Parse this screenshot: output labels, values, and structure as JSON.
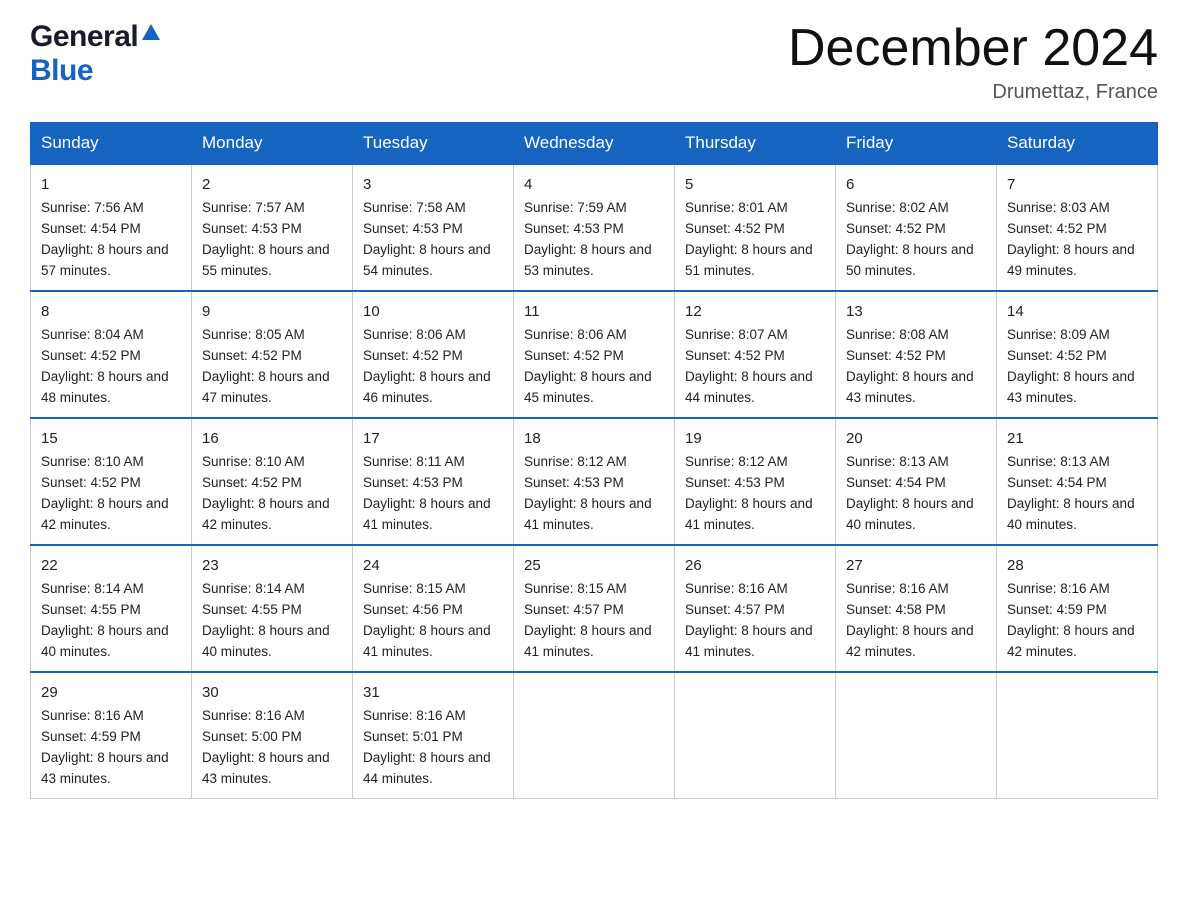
{
  "header": {
    "logo_general": "General",
    "logo_blue": "Blue",
    "month_title": "December 2024",
    "location": "Drumettaz, France"
  },
  "days_of_week": [
    "Sunday",
    "Monday",
    "Tuesday",
    "Wednesday",
    "Thursday",
    "Friday",
    "Saturday"
  ],
  "weeks": [
    [
      {
        "day": "1",
        "sunrise": "7:56 AM",
        "sunset": "4:54 PM",
        "daylight": "8 hours and 57 minutes."
      },
      {
        "day": "2",
        "sunrise": "7:57 AM",
        "sunset": "4:53 PM",
        "daylight": "8 hours and 55 minutes."
      },
      {
        "day": "3",
        "sunrise": "7:58 AM",
        "sunset": "4:53 PM",
        "daylight": "8 hours and 54 minutes."
      },
      {
        "day": "4",
        "sunrise": "7:59 AM",
        "sunset": "4:53 PM",
        "daylight": "8 hours and 53 minutes."
      },
      {
        "day": "5",
        "sunrise": "8:01 AM",
        "sunset": "4:52 PM",
        "daylight": "8 hours and 51 minutes."
      },
      {
        "day": "6",
        "sunrise": "8:02 AM",
        "sunset": "4:52 PM",
        "daylight": "8 hours and 50 minutes."
      },
      {
        "day": "7",
        "sunrise": "8:03 AM",
        "sunset": "4:52 PM",
        "daylight": "8 hours and 49 minutes."
      }
    ],
    [
      {
        "day": "8",
        "sunrise": "8:04 AM",
        "sunset": "4:52 PM",
        "daylight": "8 hours and 48 minutes."
      },
      {
        "day": "9",
        "sunrise": "8:05 AM",
        "sunset": "4:52 PM",
        "daylight": "8 hours and 47 minutes."
      },
      {
        "day": "10",
        "sunrise": "8:06 AM",
        "sunset": "4:52 PM",
        "daylight": "8 hours and 46 minutes."
      },
      {
        "day": "11",
        "sunrise": "8:06 AM",
        "sunset": "4:52 PM",
        "daylight": "8 hours and 45 minutes."
      },
      {
        "day": "12",
        "sunrise": "8:07 AM",
        "sunset": "4:52 PM",
        "daylight": "8 hours and 44 minutes."
      },
      {
        "day": "13",
        "sunrise": "8:08 AM",
        "sunset": "4:52 PM",
        "daylight": "8 hours and 43 minutes."
      },
      {
        "day": "14",
        "sunrise": "8:09 AM",
        "sunset": "4:52 PM",
        "daylight": "8 hours and 43 minutes."
      }
    ],
    [
      {
        "day": "15",
        "sunrise": "8:10 AM",
        "sunset": "4:52 PM",
        "daylight": "8 hours and 42 minutes."
      },
      {
        "day": "16",
        "sunrise": "8:10 AM",
        "sunset": "4:52 PM",
        "daylight": "8 hours and 42 minutes."
      },
      {
        "day": "17",
        "sunrise": "8:11 AM",
        "sunset": "4:53 PM",
        "daylight": "8 hours and 41 minutes."
      },
      {
        "day": "18",
        "sunrise": "8:12 AM",
        "sunset": "4:53 PM",
        "daylight": "8 hours and 41 minutes."
      },
      {
        "day": "19",
        "sunrise": "8:12 AM",
        "sunset": "4:53 PM",
        "daylight": "8 hours and 41 minutes."
      },
      {
        "day": "20",
        "sunrise": "8:13 AM",
        "sunset": "4:54 PM",
        "daylight": "8 hours and 40 minutes."
      },
      {
        "day": "21",
        "sunrise": "8:13 AM",
        "sunset": "4:54 PM",
        "daylight": "8 hours and 40 minutes."
      }
    ],
    [
      {
        "day": "22",
        "sunrise": "8:14 AM",
        "sunset": "4:55 PM",
        "daylight": "8 hours and 40 minutes."
      },
      {
        "day": "23",
        "sunrise": "8:14 AM",
        "sunset": "4:55 PM",
        "daylight": "8 hours and 40 minutes."
      },
      {
        "day": "24",
        "sunrise": "8:15 AM",
        "sunset": "4:56 PM",
        "daylight": "8 hours and 41 minutes."
      },
      {
        "day": "25",
        "sunrise": "8:15 AM",
        "sunset": "4:57 PM",
        "daylight": "8 hours and 41 minutes."
      },
      {
        "day": "26",
        "sunrise": "8:16 AM",
        "sunset": "4:57 PM",
        "daylight": "8 hours and 41 minutes."
      },
      {
        "day": "27",
        "sunrise": "8:16 AM",
        "sunset": "4:58 PM",
        "daylight": "8 hours and 42 minutes."
      },
      {
        "day": "28",
        "sunrise": "8:16 AM",
        "sunset": "4:59 PM",
        "daylight": "8 hours and 42 minutes."
      }
    ],
    [
      {
        "day": "29",
        "sunrise": "8:16 AM",
        "sunset": "4:59 PM",
        "daylight": "8 hours and 43 minutes."
      },
      {
        "day": "30",
        "sunrise": "8:16 AM",
        "sunset": "5:00 PM",
        "daylight": "8 hours and 43 minutes."
      },
      {
        "day": "31",
        "sunrise": "8:16 AM",
        "sunset": "5:01 PM",
        "daylight": "8 hours and 44 minutes."
      },
      null,
      null,
      null,
      null
    ]
  ]
}
